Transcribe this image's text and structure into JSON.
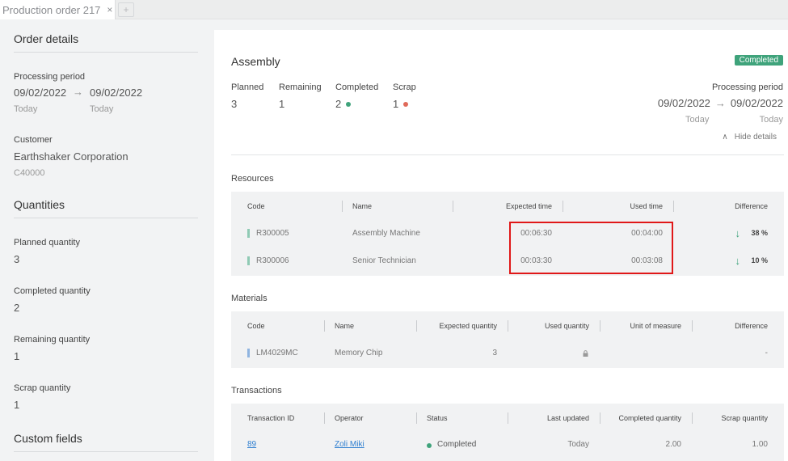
{
  "tab": {
    "title": "Production order 217",
    "close": "×",
    "add": "+"
  },
  "sidebar": {
    "order_details": "Order details",
    "processing_period_label": "Processing period",
    "start_date": "09/02/2022",
    "end_date": "09/02/2022",
    "start_sub": "Today",
    "end_sub": "Today",
    "customer_label": "Customer",
    "customer_name": "Earthshaker Corporation",
    "customer_code": "C40000",
    "quantities": "Quantities",
    "planned_label": "Planned quantity",
    "planned_value": "3",
    "completed_label": "Completed quantity",
    "completed_value": "2",
    "remaining_label": "Remaining quantity",
    "remaining_value": "1",
    "scrap_label": "Scrap quantity",
    "scrap_value": "1",
    "custom_fields": "Custom fields"
  },
  "main": {
    "title": "Assembly",
    "status": "Completed",
    "stats": {
      "planned_label": "Planned",
      "planned_value": "3",
      "remaining_label": "Remaining",
      "remaining_value": "1",
      "completed_label": "Completed",
      "completed_value": "2",
      "scrap_label": "Scrap",
      "scrap_value": "1"
    },
    "period": {
      "label": "Processing period",
      "start": "09/02/2022",
      "end": "09/02/2022",
      "start_sub": "Today",
      "end_sub": "Today"
    },
    "hide_details": "Hide details",
    "resources": {
      "title": "Resources",
      "headers": {
        "code": "Code",
        "name": "Name",
        "expected": "Expected time",
        "used": "Used time",
        "difference": "Difference"
      },
      "rows": [
        {
          "code": "R300005",
          "name": "Assembly Machine",
          "expected": "00:06:30",
          "used": "00:04:00",
          "difference": "38 %"
        },
        {
          "code": "R300006",
          "name": "Senior Technician",
          "expected": "00:03:30",
          "used": "00:03:08",
          "difference": "10 %"
        }
      ]
    },
    "materials": {
      "title": "Materials",
      "headers": {
        "code": "Code",
        "name": "Name",
        "expected": "Expected quantity",
        "used": "Used quantity",
        "uom": "Unit of measure",
        "difference": "Difference"
      },
      "rows": [
        {
          "code": "LM4029MC",
          "name": "Memory Chip",
          "expected": "3",
          "used": "",
          "uom": "",
          "difference": "-"
        }
      ]
    },
    "transactions": {
      "title": "Transactions",
      "headers": {
        "id": "Transaction ID",
        "operator": "Operator",
        "status": "Status",
        "updated": "Last updated",
        "completed": "Completed quantity",
        "scrap": "Scrap quantity"
      },
      "rows": [
        {
          "id": "89",
          "operator": "Zoli Miki",
          "status": "Completed",
          "updated": "Today",
          "completed": "2.00",
          "scrap": "1.00"
        }
      ]
    }
  },
  "colors": {
    "accent": "#3fa37b",
    "scrap": "#e06a5a",
    "resource_bar": "#8fcab4",
    "material_bar": "#8fb4e0",
    "link": "#2f7fd0",
    "highlight": "#e01818"
  }
}
